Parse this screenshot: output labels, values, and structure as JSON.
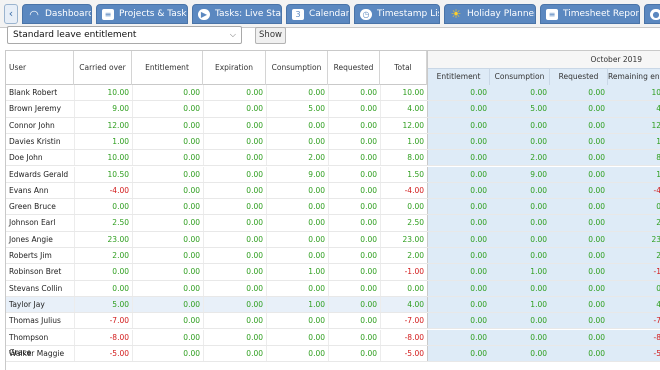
{
  "tabs": [
    {
      "label": "Dashboard",
      "icon": "dashboard-icon",
      "glyph": "◠"
    },
    {
      "label": "Projects & Tasks",
      "icon": "projects-icon",
      "glyph": "≡"
    },
    {
      "label": "Tasks: Live Start",
      "icon": "play-icon",
      "glyph": "▶"
    },
    {
      "label": "Calendar",
      "icon": "calendar-icon",
      "glyph": "3"
    },
    {
      "label": "Timestamp List",
      "icon": "clock-icon",
      "glyph": "◷"
    },
    {
      "label": "Holiday Planner",
      "icon": "sun-icon",
      "glyph": "☀"
    },
    {
      "label": "Timesheet Report",
      "icon": "report-icon",
      "glyph": "≡"
    },
    {
      "label": "",
      "icon": "user-icon",
      "glyph": "●"
    }
  ],
  "back_glyph": "‹",
  "filter": {
    "selected": "Standard leave entitlement",
    "chevron": "⌵",
    "show_label": "Show"
  },
  "columns": {
    "user": "User",
    "carried_over": "Carried over",
    "entitlement": "Entitlement",
    "expiration": "Expiration",
    "consumption": "Consumption",
    "requested": "Requested",
    "total": "Total"
  },
  "month_header": "October 2019",
  "month_columns": {
    "entitlement": "Entitlement",
    "consumption": "Consumption",
    "requested": "Requested",
    "remaining": "Remaining en..."
  },
  "rows": [
    {
      "user": "Blank Robert",
      "cells": [
        "10.00",
        "0.00",
        "0.00",
        "0.00",
        "0.00",
        "10.00"
      ],
      "month": [
        "0.00",
        "0.00",
        "0.00",
        "10"
      ]
    },
    {
      "user": "Brown Jeremy",
      "cells": [
        "9.00",
        "0.00",
        "0.00",
        "5.00",
        "0.00",
        "4.00"
      ],
      "month": [
        "0.00",
        "5.00",
        "0.00",
        "4"
      ]
    },
    {
      "user": "Connor John",
      "cells": [
        "12.00",
        "0.00",
        "0.00",
        "0.00",
        "0.00",
        "12.00"
      ],
      "month": [
        "0.00",
        "0.00",
        "0.00",
        "12"
      ]
    },
    {
      "user": "Davies Kristin",
      "cells": [
        "1.00",
        "0.00",
        "0.00",
        "0.00",
        "0.00",
        "1.00"
      ],
      "month": [
        "0.00",
        "0.00",
        "0.00",
        "1"
      ]
    },
    {
      "user": "Doe John",
      "cells": [
        "10.00",
        "0.00",
        "0.00",
        "2.00",
        "0.00",
        "8.00"
      ],
      "month": [
        "0.00",
        "2.00",
        "0.00",
        "8"
      ]
    },
    {
      "user": "Edwards Gerald",
      "cells": [
        "10.50",
        "0.00",
        "0.00",
        "9.00",
        "0.00",
        "1.50"
      ],
      "month": [
        "0.00",
        "9.00",
        "0.00",
        "1"
      ]
    },
    {
      "user": "Evans Ann",
      "cells": [
        "-4.00",
        "0.00",
        "0.00",
        "0.00",
        "0.00",
        "-4.00"
      ],
      "month": [
        "0.00",
        "0.00",
        "0.00",
        "-4"
      ]
    },
    {
      "user": "Green Bruce",
      "cells": [
        "0.00",
        "0.00",
        "0.00",
        "0.00",
        "0.00",
        "0.00"
      ],
      "month": [
        "0.00",
        "0.00",
        "0.00",
        "0"
      ]
    },
    {
      "user": "Johnson Earl",
      "cells": [
        "2.50",
        "0.00",
        "0.00",
        "0.00",
        "0.00",
        "2.50"
      ],
      "month": [
        "0.00",
        "0.00",
        "0.00",
        "2"
      ]
    },
    {
      "user": "Jones Angie",
      "cells": [
        "23.00",
        "0.00",
        "0.00",
        "0.00",
        "0.00",
        "23.00"
      ],
      "month": [
        "0.00",
        "0.00",
        "0.00",
        "23"
      ]
    },
    {
      "user": "Roberts Jim",
      "cells": [
        "2.00",
        "0.00",
        "0.00",
        "0.00",
        "0.00",
        "2.00"
      ],
      "month": [
        "0.00",
        "0.00",
        "0.00",
        "2"
      ]
    },
    {
      "user": "Robinson Bret",
      "cells": [
        "0.00",
        "0.00",
        "0.00",
        "1.00",
        "0.00",
        "-1.00"
      ],
      "month": [
        "0.00",
        "1.00",
        "0.00",
        "-1"
      ]
    },
    {
      "user": "Stevans Collin",
      "cells": [
        "0.00",
        "0.00",
        "0.00",
        "0.00",
        "0.00",
        "0.00"
      ],
      "month": [
        "0.00",
        "0.00",
        "0.00",
        "0"
      ]
    },
    {
      "user": "Taylor Jay",
      "cells": [
        "5.00",
        "0.00",
        "0.00",
        "1.00",
        "0.00",
        "4.00"
      ],
      "month": [
        "0.00",
        "1.00",
        "0.00",
        "4"
      ],
      "selected": true
    },
    {
      "user": "Thomas Julius",
      "cells": [
        "-7.00",
        "0.00",
        "0.00",
        "0.00",
        "0.00",
        "-7.00"
      ],
      "month": [
        "0.00",
        "0.00",
        "0.00",
        "-7"
      ]
    },
    {
      "user": "Thompson Grace",
      "cells": [
        "-8.00",
        "0.00",
        "0.00",
        "0.00",
        "0.00",
        "-8.00"
      ],
      "month": [
        "0.00",
        "0.00",
        "0.00",
        "-8"
      ]
    },
    {
      "user": "Walker Maggie",
      "cells": [
        "-5.00",
        "0.00",
        "0.00",
        "0.00",
        "0.00",
        "-5.00"
      ],
      "month": [
        "0.00",
        "0.00",
        "0.00",
        "-5"
      ]
    }
  ],
  "colors": {
    "positive": "#2e9e1e",
    "negative": "#d21c1c",
    "tab": "#5b88c0",
    "month_bg": "#deebf7"
  }
}
